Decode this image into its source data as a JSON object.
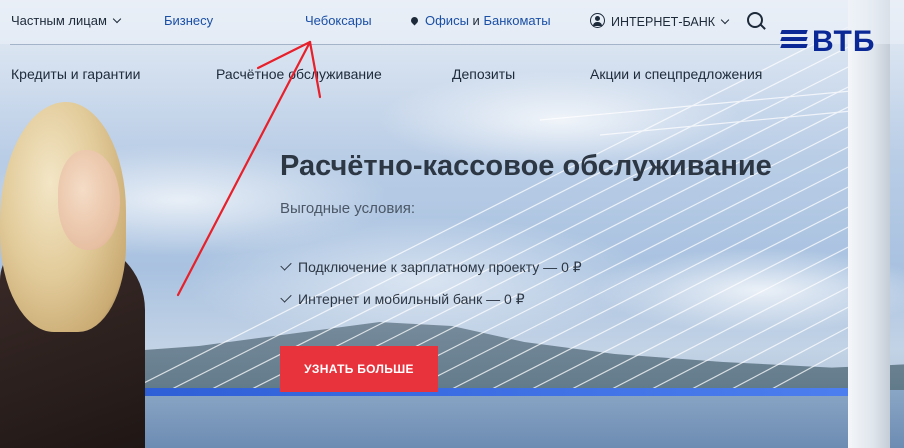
{
  "topbar": {
    "private_label": "Частным лицам",
    "business_label": "Бизнесу",
    "city_label": "Чебоксары",
    "offices_label": "Офисы",
    "and_label": "и",
    "atms_label": "Банкоматы",
    "internet_bank_label": "ИНТЕРНЕТ-БАНК"
  },
  "logo": {
    "text": "ВТБ"
  },
  "nav": {
    "items": [
      {
        "label": "Кредиты и гарантии"
      },
      {
        "label": "Расчётное обслуживание"
      },
      {
        "label": "Депозиты"
      },
      {
        "label": "Акции и спецпредложения"
      }
    ]
  },
  "hero": {
    "title": "Расчётно-кассовое обслуживание",
    "subtitle": "Выгодные условия:",
    "features": [
      {
        "text": "Подключение к зарплатному проекту — 0 ₽"
      },
      {
        "text": "Интернет и мобильный банк — 0 ₽"
      }
    ],
    "cta_label": "УЗНАТЬ БОЛЬШЕ"
  },
  "colors": {
    "brand_blue": "#0a2896",
    "link_blue": "#1a4fa6",
    "cta_red": "#e8323c",
    "annotation_arrow": "#e8202a"
  },
  "icons": [
    "chevron-down-icon",
    "location-pin-icon",
    "user-icon",
    "search-icon",
    "check-icon",
    "vtb-logo"
  ]
}
